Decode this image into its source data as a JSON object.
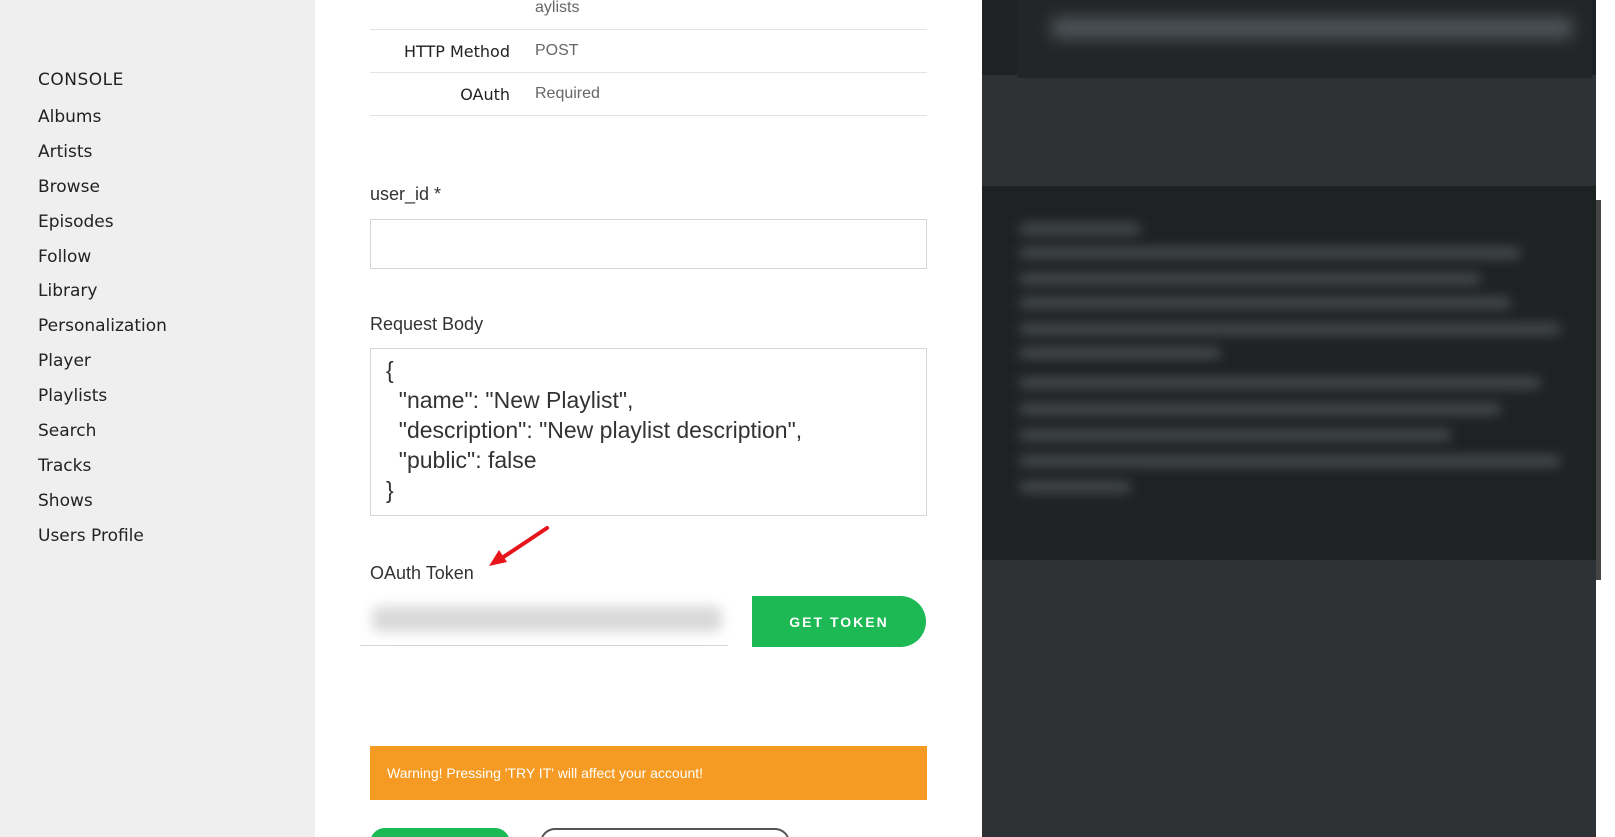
{
  "sidebar": {
    "heading": "CONSOLE",
    "items": [
      {
        "label": "Albums"
      },
      {
        "label": "Artists"
      },
      {
        "label": "Browse"
      },
      {
        "label": "Episodes"
      },
      {
        "label": "Follow"
      },
      {
        "label": "Library"
      },
      {
        "label": "Personalization"
      },
      {
        "label": "Player"
      },
      {
        "label": "Playlists"
      },
      {
        "label": "Search"
      },
      {
        "label": "Tracks"
      },
      {
        "label": "Shows"
      },
      {
        "label": "Users Profile"
      }
    ]
  },
  "endpoint": {
    "partial_value": "aylists",
    "rows": [
      {
        "key": "HTTP Method",
        "value": "POST"
      },
      {
        "key": "OAuth",
        "value": "Required"
      }
    ]
  },
  "form": {
    "user_id_label": "user_id *",
    "user_id_value": "",
    "request_body_label": "Request Body",
    "request_body": "{\n  \"name\": \"New Playlist\",\n  \"description\": \"New playlist description\",\n  \"public\": false\n}",
    "oauth_token_label": "OAuth Token",
    "get_token_label": "GET TOKEN",
    "warning": "Warning! Pressing 'TRY IT' will affect your account!"
  },
  "colors": {
    "accent_green": "#1db954",
    "warning_orange": "#f59b23",
    "annotation_red": "#e8141b",
    "sidebar_bg": "#efefef",
    "panel_dark": "#2e3234"
  }
}
